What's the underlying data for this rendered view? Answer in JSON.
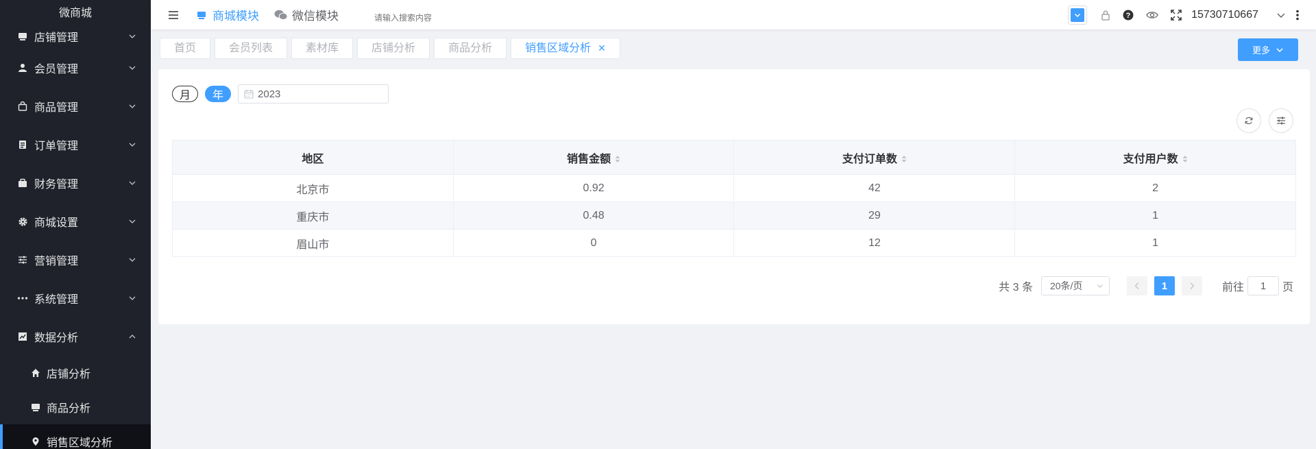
{
  "sidebar": {
    "brand": "微商城",
    "items": [
      {
        "label": "店铺管理",
        "icon": "store-icon",
        "expanded": false
      },
      {
        "label": "会员管理",
        "icon": "user-icon",
        "expanded": false
      },
      {
        "label": "商品管理",
        "icon": "bag-icon",
        "expanded": false
      },
      {
        "label": "订单管理",
        "icon": "order-icon",
        "expanded": false
      },
      {
        "label": "财务管理",
        "icon": "wallet-icon",
        "expanded": false
      },
      {
        "label": "商城设置",
        "icon": "gear-icon",
        "expanded": false
      },
      {
        "label": "营销管理",
        "icon": "sliders-icon",
        "expanded": false
      },
      {
        "label": "系统管理",
        "icon": "more-dots-icon",
        "expanded": false
      },
      {
        "label": "数据分析",
        "icon": "chart-icon",
        "expanded": true
      }
    ],
    "sub_items": [
      {
        "label": "店铺分析",
        "icon": "home-icon"
      },
      {
        "label": "商品分析",
        "icon": "product-icon"
      },
      {
        "label": "销售区域分析",
        "icon": "location-icon",
        "active": true
      }
    ]
  },
  "topbar": {
    "modules": [
      {
        "label": "商城模块",
        "icon": "shop-module-icon",
        "active": true
      },
      {
        "label": "微信模块",
        "icon": "wechat-icon",
        "active": false
      }
    ],
    "search_placeholder": "请输入搜索内容",
    "username": "15730710667"
  },
  "tabs": [
    {
      "label": "首页"
    },
    {
      "label": "会员列表"
    },
    {
      "label": "素材库"
    },
    {
      "label": "店铺分析"
    },
    {
      "label": "商品分析"
    },
    {
      "label": "销售区域分析",
      "active": true,
      "closable": true
    }
  ],
  "more_button": "更多",
  "filter": {
    "month": "月",
    "year": "年",
    "selected": "年",
    "date_value": "2023"
  },
  "table": {
    "columns": [
      {
        "label": "地区",
        "sortable": false
      },
      {
        "label": "销售金额",
        "sortable": true
      },
      {
        "label": "支付订单数",
        "sortable": true
      },
      {
        "label": "支付用户数",
        "sortable": true
      }
    ],
    "rows": [
      [
        "北京市",
        "0.92",
        "42",
        "2"
      ],
      [
        "重庆市",
        "0.48",
        "29",
        "1"
      ],
      [
        "眉山市",
        "0",
        "12",
        "1"
      ]
    ]
  },
  "pagination": {
    "total": "共 3 条",
    "page_size": "20条/页",
    "current_page": "1",
    "goto_prefix": "前往",
    "goto_value": "1",
    "goto_suffix": "页"
  },
  "colors": {
    "accent": "#409eff",
    "sidebar_bg": "#1f222b"
  }
}
